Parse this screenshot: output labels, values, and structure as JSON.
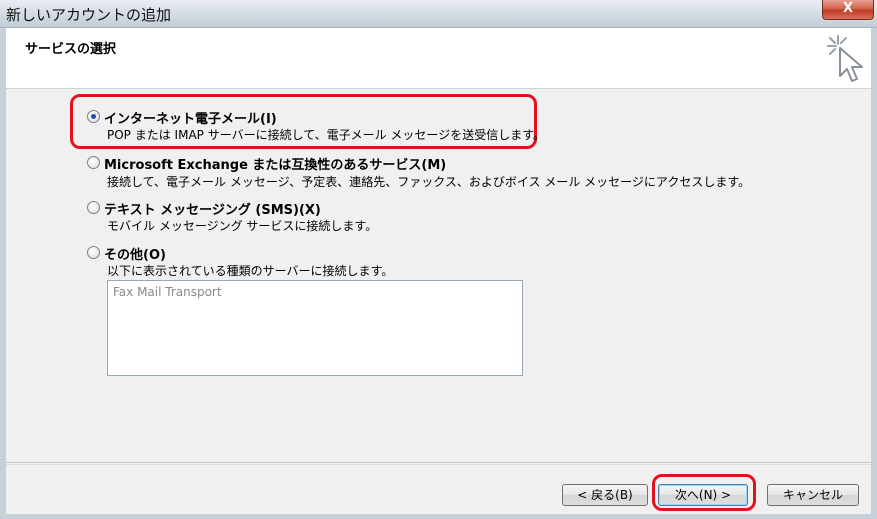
{
  "window": {
    "title": "新しいアカウントの追加",
    "close_label": "X"
  },
  "header": {
    "title": "サービスの選択"
  },
  "options": [
    {
      "label": "インターネット電子メール(I)",
      "description": "POP または IMAP サーバーに接続して、電子メール メッセージを送受信します。",
      "selected": true
    },
    {
      "label": "Microsoft Exchange または互換性のあるサービス(M)",
      "description": "接続して、電子メール メッセージ、予定表、連絡先、ファックス、およびボイス メール メッセージにアクセスします。",
      "selected": false
    },
    {
      "label": "テキスト メッセージング (SMS)(X)",
      "description": "モバイル メッセージング サービスに接続します。",
      "selected": false
    },
    {
      "label": "その他(O)",
      "description": "以下に表示されている種類のサーバーに接続します。",
      "selected": false
    }
  ],
  "other_list": {
    "items": [
      "Fax Mail Transport"
    ]
  },
  "buttons": {
    "back": "< 戻る(B)",
    "next": "次へ(N) >",
    "cancel": "キャンセル"
  },
  "colors": {
    "highlight": "#e0141e",
    "radio_dot": "#1f4fa0",
    "default_button_border": "#3c7fb1"
  }
}
